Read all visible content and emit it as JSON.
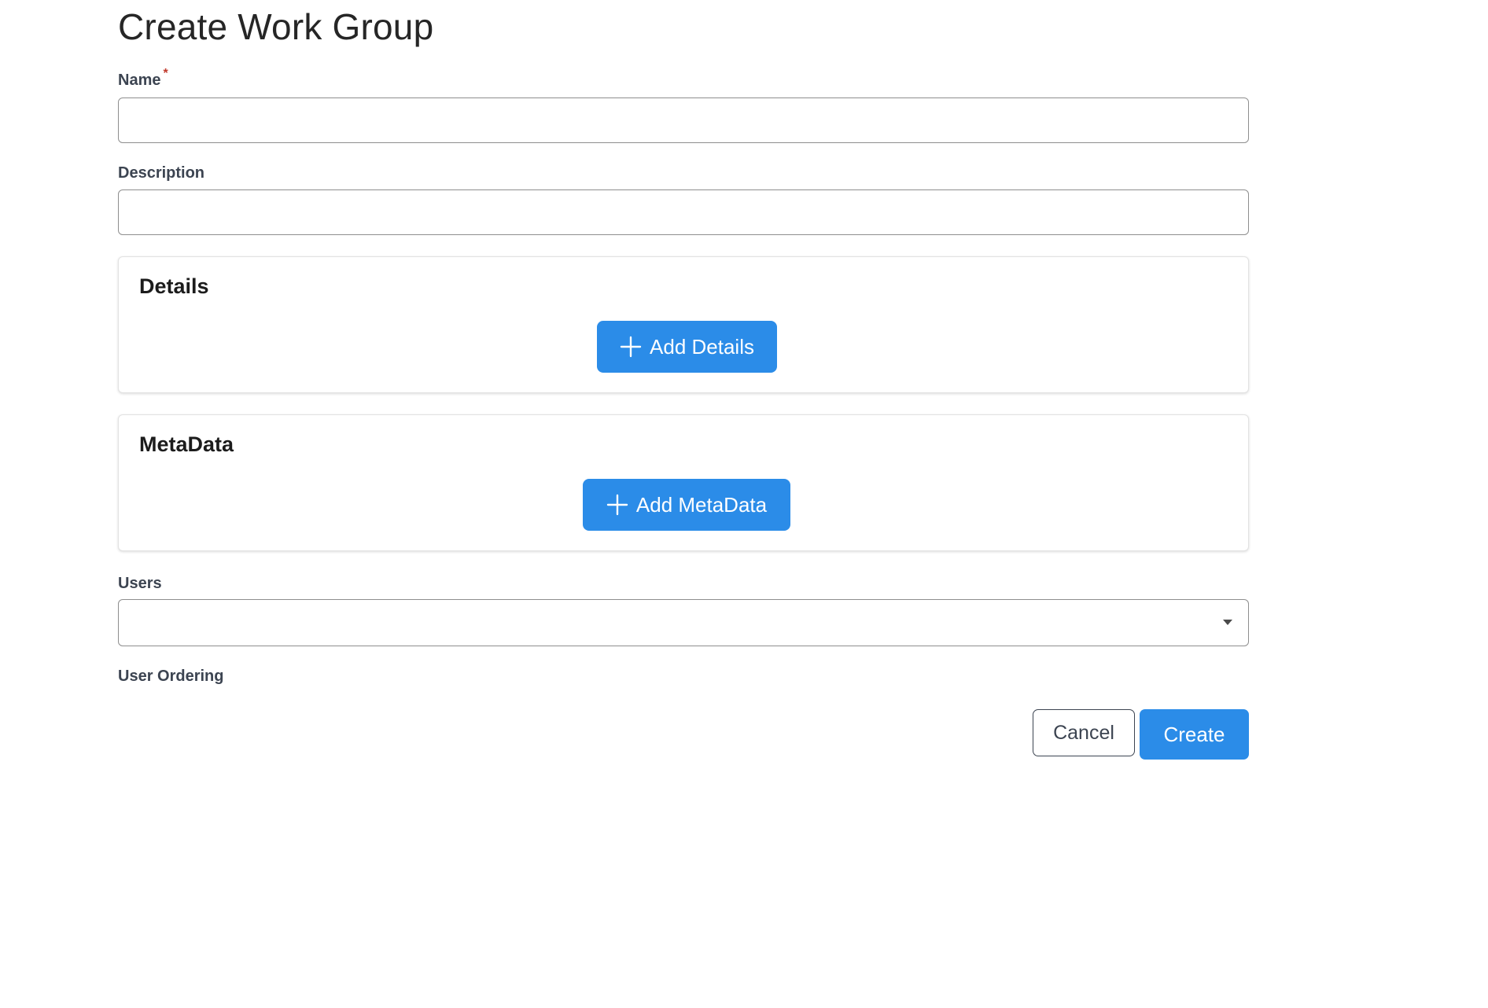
{
  "page": {
    "title": "Create Work Group"
  },
  "form": {
    "name": {
      "label": "Name",
      "required_mark": "*",
      "value": "",
      "placeholder": ""
    },
    "description": {
      "label": "Description",
      "value": "",
      "placeholder": ""
    },
    "details_panel": {
      "title": "Details",
      "add_button_label": "Add Details",
      "add_button_icon": "plus-icon"
    },
    "metadata_panel": {
      "title": "MetaData",
      "add_button_label": "Add MetaData",
      "add_button_icon": "plus-icon"
    },
    "users": {
      "label": "Users",
      "selected_value": "",
      "dropdown_icon": "caret-down-icon"
    },
    "user_ordering": {
      "label": "User Ordering"
    }
  },
  "actions": {
    "cancel_label": "Cancel",
    "create_label": "Create"
  },
  "colors": {
    "primary": "#2b8ce8",
    "required": "#c0392b",
    "label_text": "#3c4451",
    "input_border": "#8e8e8e"
  }
}
